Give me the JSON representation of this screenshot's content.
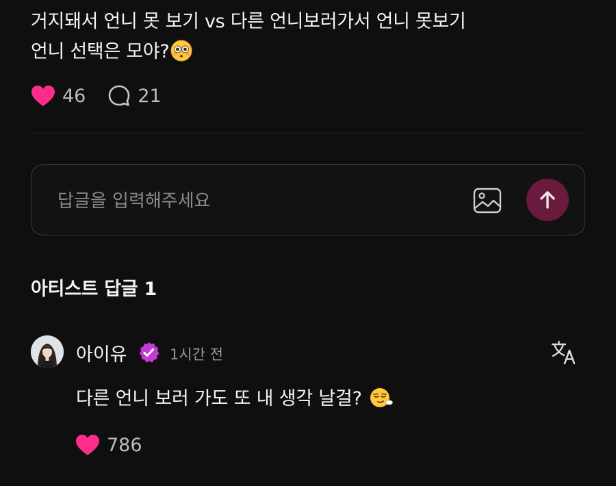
{
  "post": {
    "line1": "거지돼서 언니 못 보기 vs 다른 언니보러가서 언니 못보기",
    "line2": "언니 선택은 모야?",
    "line2_emoji": "flushed-face-emoji"
  },
  "stats": {
    "likes": "46",
    "replies": "21",
    "like_color": "#ff2d8a"
  },
  "reply_box": {
    "placeholder": "답글을 입력해주세요",
    "image_icon": "image-icon",
    "send_icon": "arrow-up-icon",
    "send_color": "#6a1a3d"
  },
  "artist_replies": {
    "title": "아티스트 답글 1"
  },
  "comment": {
    "author": "아이유",
    "verified_icon": "verified-badge-icon",
    "verified_color": "#c43ad6",
    "time": "1시간 전",
    "translate_icon": "translate-icon",
    "text": "다른 언니 보러 가도 또 내 생각 날걸?",
    "text_emoji": "smirking-face-emoji",
    "likes": "786"
  }
}
